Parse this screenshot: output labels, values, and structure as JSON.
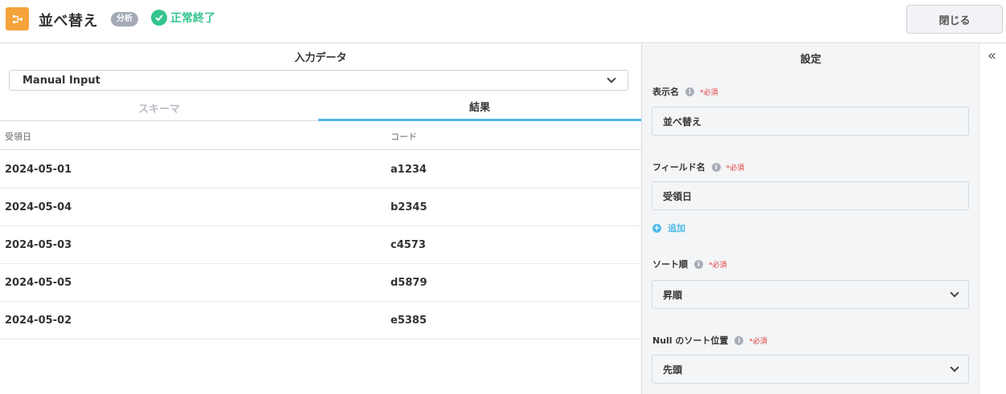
{
  "header": {
    "title": "並べ替え",
    "badge": "分析",
    "status": "正常終了",
    "close_label": "閉じる",
    "node_icon": "sort-node-icon",
    "status_icon": "check-circle-icon"
  },
  "input_panel": {
    "title": "入力データ",
    "selected_source": "Manual Input",
    "tabs": [
      {
        "label": "スキーマ",
        "active": false
      },
      {
        "label": "結果",
        "active": true
      }
    ],
    "table": {
      "columns": [
        "受領日",
        "コード"
      ],
      "rows": [
        [
          "2024-05-01",
          "a1234"
        ],
        [
          "2024-05-04",
          "b2345"
        ],
        [
          "2024-05-03",
          "c4573"
        ],
        [
          "2024-05-05",
          "d5879"
        ],
        [
          "2024-05-02",
          "e5385"
        ]
      ]
    }
  },
  "settings": {
    "title": "設定",
    "display_name": {
      "label": "表示名",
      "required": "*必須",
      "value": "並べ替え"
    },
    "field_name": {
      "label": "フィールド名",
      "required": "*必須",
      "value": "受領日"
    },
    "add_label": "追加",
    "sort_order": {
      "label": "ソート順",
      "required": "*必須",
      "value": "昇順"
    },
    "null_position": {
      "label": "Null のソート位置",
      "required": "*必須",
      "value": "先頭"
    }
  },
  "colors": {
    "accent_orange": "#f5a33b",
    "success_green": "#34c48e",
    "tab_blue": "#4db8e6",
    "required_red": "#e03a3a"
  }
}
